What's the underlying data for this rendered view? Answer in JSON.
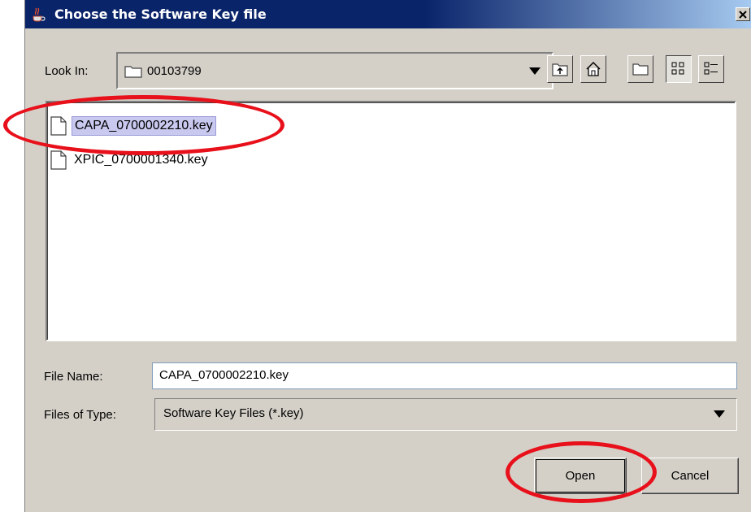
{
  "window": {
    "title": "Choose the Software Key file",
    "close_label": "x"
  },
  "look_in": {
    "label": "Look In:",
    "value": "00103799"
  },
  "toolbar": {
    "icons": [
      "up-one-level-icon",
      "home-icon",
      "new-folder-icon",
      "list-view-icon",
      "details-view-icon"
    ]
  },
  "files": [
    {
      "name": "CAPA_0700002210.key",
      "selected": true
    },
    {
      "name": "XPIC_0700001340.key",
      "selected": false
    }
  ],
  "file_name": {
    "label": "File Name:",
    "value": "CAPA_0700002210.key"
  },
  "files_of_type": {
    "label": "Files of Type:",
    "value": "Software Key Files (*.key)"
  },
  "buttons": {
    "open": "Open",
    "cancel": "Cancel"
  },
  "colors": {
    "titlebar": "#0a246a",
    "selection": "#c9c9f0",
    "annotation": "#e8101a"
  }
}
